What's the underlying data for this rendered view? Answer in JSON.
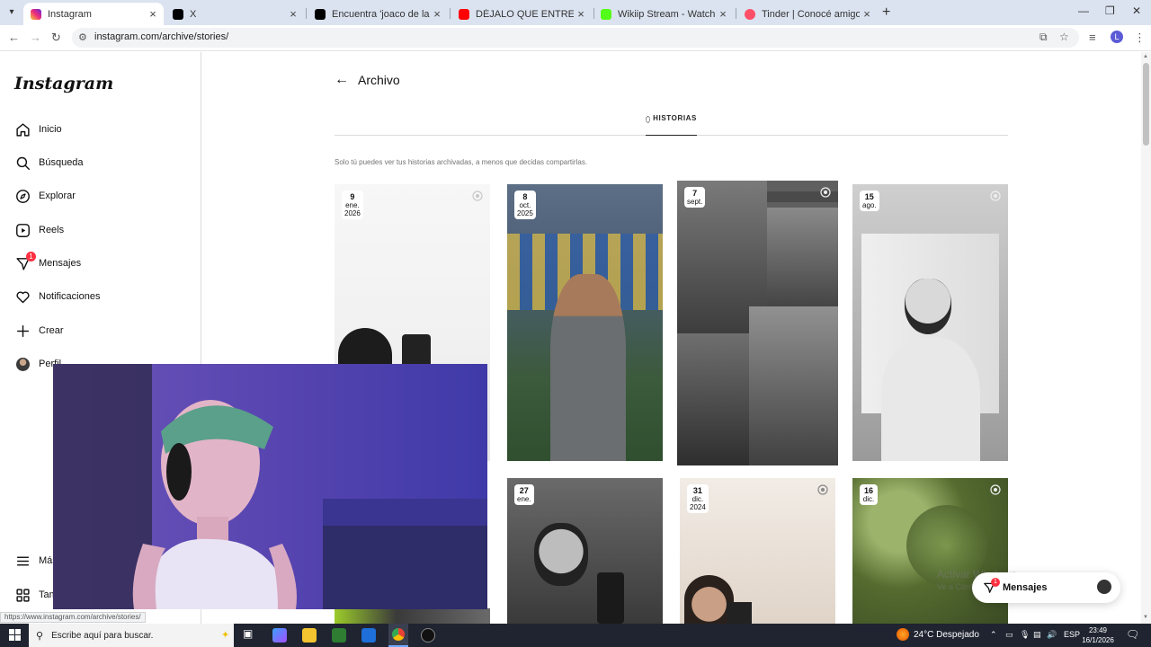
{
  "browser": {
    "tabs": [
      {
        "title": "Instagram",
        "color": "#e1306c",
        "active": true
      },
      {
        "title": "X",
        "color": "#000000",
        "active": false
      },
      {
        "title": "Encuentra 'joaco de la rosa tem",
        "color": "#000000",
        "active": false
      },
      {
        "title": "DÉJALO QUE ENTRE - Elian G (",
        "color": "#ff0000",
        "active": false
      },
      {
        "title": "Wikiip Stream - Watch Live on",
        "color": "#53fc18",
        "active": false
      },
      {
        "title": "Tinder | Conocé amigos y gente",
        "color": "#fd5068",
        "active": false
      }
    ],
    "url": "instagram.com/archive/stories/",
    "profile_initial": "L",
    "status_url": "https://www.instagram.com/archive/stories/"
  },
  "sidebar": {
    "logo": "Instagram",
    "items": [
      {
        "label": "Inicio",
        "icon": "home-icon"
      },
      {
        "label": "Búsqueda",
        "icon": "search-icon"
      },
      {
        "label": "Explorar",
        "icon": "compass-icon"
      },
      {
        "label": "Reels",
        "icon": "reels-icon"
      },
      {
        "label": "Mensajes",
        "icon": "messenger-icon",
        "badge": "1"
      },
      {
        "label": "Notificaciones",
        "icon": "heart-icon"
      },
      {
        "label": "Crear",
        "icon": "plus-icon"
      },
      {
        "label": "Perfil",
        "icon": "avatar"
      }
    ],
    "bottom_items": [
      {
        "label": "Más",
        "icon": "menu-icon"
      },
      {
        "label": "También de Meta",
        "icon": "grid-icon"
      }
    ]
  },
  "main": {
    "title": "Archivo",
    "tab_label": "HISTORIAS",
    "info": "Solo tú puedes ver tus historias archivadas, a menos que decidas compartirlas.",
    "stories": [
      {
        "day": "9",
        "month": "ene.",
        "year": "2026"
      },
      {
        "day": "8",
        "month": "oct.",
        "year": "2025"
      },
      {
        "day": "7",
        "month": "sept.",
        "year": ""
      },
      {
        "day": "15",
        "month": "ago.",
        "year": ""
      },
      {
        "day": "27",
        "month": "ene.",
        "year": ""
      },
      {
        "day": "31",
        "month": "dic.",
        "year": "2024"
      },
      {
        "day": "16",
        "month": "dic.",
        "year": ""
      }
    ]
  },
  "messages_pill": {
    "label": "Mensajes",
    "badge": "1"
  },
  "watermark": {
    "line1": "Activar Windows",
    "line2": "Ve a Configuración para activar Windows."
  },
  "taskbar": {
    "search_placeholder": "Escribe aquí para buscar.",
    "weather": "24°C  Despejado",
    "language": "ESP",
    "time": "23:49",
    "date": "16/1/2026"
  }
}
